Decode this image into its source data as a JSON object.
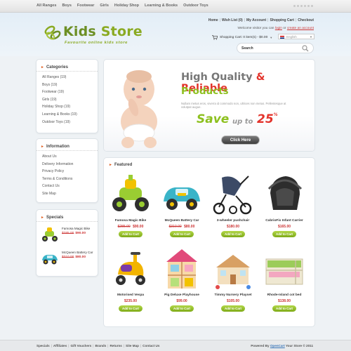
{
  "topnav": {
    "items": [
      "All Ranges",
      "Boys",
      "Footwear",
      "Girls",
      "Holiday Shop",
      "Learning & Books",
      "Outdoor Toys"
    ]
  },
  "header": {
    "logo_word1": "Kids",
    "logo_word2": "Store",
    "tagline": "Favourite online kids store",
    "links": [
      "Home",
      "Wish List (0)",
      "My Account",
      "Shopping Cart",
      "Checkout"
    ],
    "welcome_prefix": "Welcome visitor you can",
    "login": "login",
    "welcome_or": "or",
    "create_account": "create an account",
    "cart_summary": "Shopping Cart: 0 item(s) - $0.00",
    "language": "English",
    "search_label": "Search"
  },
  "categories": {
    "title": "Categories",
    "items": [
      "All Ranges (19)",
      "Boys (19)",
      "Footwear (19)",
      "Girls (19)",
      "Holiday Shop (19)",
      "Learning & Books (19)",
      "Outdoor Toys (19)"
    ]
  },
  "information": {
    "title": "Information",
    "items": [
      "About Us",
      "Delivery Information",
      "Privacy Policy",
      "Terms & Conditions",
      "Contact Us",
      "Site Map"
    ]
  },
  "specials": {
    "title": "Specials",
    "items": [
      {
        "name": "Famosa Magic Bike",
        "old_price": "$285.00",
        "new_price": "$90.00"
      },
      {
        "name": "McQueen Battery Car",
        "old_price": "$310.00",
        "new_price": "$80.00"
      }
    ]
  },
  "banner": {
    "line1a": "High Quality",
    "line1amp": "&",
    "line1b": "Reliable",
    "line2": "Products",
    "lorem": "Nullam metus eros, viverra id commodo non, ultrices non metus. Pellentesque at volutpat augue.",
    "save": "Save",
    "upto": "up to",
    "percent": "25",
    "percent_sign": "%",
    "button": "Click Here"
  },
  "featured": {
    "title": "Featured",
    "cart_label": "Add to Cart",
    "products": [
      {
        "name": "Famosa Magic Bike",
        "old_price": "$285.00",
        "new_price": "$90.00"
      },
      {
        "name": "McQueen Battery Car",
        "old_price": "$310.00",
        "new_price": "$80.00"
      },
      {
        "name": "3-wheeler pushchair",
        "old_price": "",
        "new_price": "$180.00"
      },
      {
        "name": "CabrioFix Infant Carrier",
        "old_price": "",
        "new_price": "$165.00"
      },
      {
        "name": "Motorised Vespa",
        "old_price": "",
        "new_price": "$235.00"
      },
      {
        "name": "Pig Deluxe Playhouse",
        "old_price": "",
        "new_price": "$99.00"
      },
      {
        "name": "Timmy Nursery Playset",
        "old_price": "",
        "new_price": "$105.00"
      },
      {
        "name": "Rhode-Island cot bed",
        "old_price": "",
        "new_price": "$138.00"
      }
    ]
  },
  "footer": {
    "links": [
      "Specials",
      "Affiliates",
      "Gift Vouchers",
      "Brands",
      "Returns",
      "Site Map",
      "Contact Us"
    ],
    "powered_prefix": "Powered By",
    "opencart": "OpenCart",
    "powered_suffix": "Your Store © 2011"
  },
  "colors": {
    "brand_green": "#8aaa22",
    "accent_red": "#e3332b",
    "button_green": "#7eaa17"
  }
}
